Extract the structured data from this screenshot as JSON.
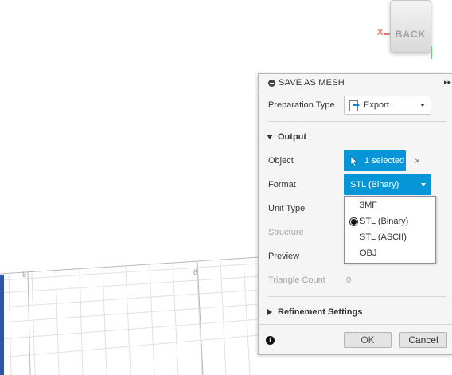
{
  "viewport": {
    "navcube_face_label": "BACK",
    "axis_x_label": "X",
    "grid_labels": [
      "8",
      "8"
    ]
  },
  "dialog": {
    "title": "SAVE AS MESH",
    "preparation_type": {
      "label": "Preparation Type",
      "value": "Export",
      "icon": "export-icon"
    },
    "output_section": {
      "label": "Output",
      "expanded": true
    },
    "object": {
      "label": "Object",
      "selection_text": "1 selected",
      "clear_symbol": "×"
    },
    "format": {
      "label": "Format",
      "value": "STL (Binary)",
      "dropdown_open": true,
      "options": [
        "3MF",
        "STL (Binary)",
        "STL (ASCII)",
        "OBJ"
      ],
      "selected_option": "STL (Binary)"
    },
    "unit_type": {
      "label": "Unit Type"
    },
    "structure": {
      "label": "Structure",
      "disabled": true
    },
    "preview": {
      "label": "Preview"
    },
    "triangle_count": {
      "label": "Triangle Count",
      "value": "0",
      "disabled": true
    },
    "refinement_section": {
      "label": "Refinement Settings",
      "expanded": false
    },
    "footer": {
      "info_symbol": "i",
      "ok_label": "OK",
      "cancel_label": "Cancel"
    }
  },
  "colors": {
    "accent_blue": "#0696d7",
    "axis_x": "#e27575",
    "axis_y": "#6bd36b",
    "body_edge": "#2f56a6"
  }
}
